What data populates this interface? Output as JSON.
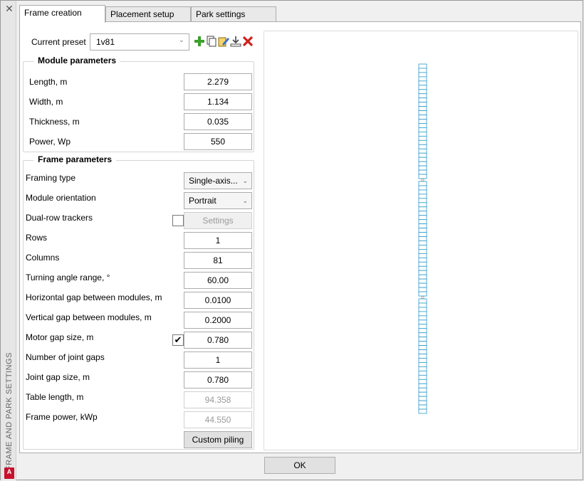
{
  "window": {
    "vertical_title": "FRAME AND PARK SETTINGS",
    "logo_letter": "A"
  },
  "tabs": [
    {
      "label": "Frame creation"
    },
    {
      "label": "Placement setup"
    },
    {
      "label": "Park settings"
    }
  ],
  "preset": {
    "label": "Current preset",
    "value": "1v81",
    "icons": [
      "add-preset-icon",
      "copy-preset-icon",
      "edit-preset-icon",
      "export-preset-icon",
      "delete-preset-icon"
    ]
  },
  "module_parameters": {
    "title": "Module parameters",
    "rows": [
      {
        "label": "Length, m",
        "value": "2.279"
      },
      {
        "label": "Width, m",
        "value": "1.134"
      },
      {
        "label": "Thickness, m",
        "value": "0.035"
      },
      {
        "label": "Power, Wp",
        "value": "550"
      }
    ]
  },
  "frame_parameters": {
    "title": "Frame parameters",
    "framing_type": {
      "label": "Framing type",
      "value": "Single-axis..."
    },
    "module_orientation": {
      "label": "Module orientation",
      "value": "Portrait"
    },
    "dual_row": {
      "label": "Dual-row trackers",
      "checked": false,
      "settings_label": "Settings"
    },
    "rows": {
      "label": "Rows",
      "value": "1"
    },
    "columns": {
      "label": "Columns",
      "value": "81"
    },
    "turning_angle": {
      "label": "Turning angle range, °",
      "value": "60.00"
    },
    "h_gap": {
      "label": "Horizontal gap between modules, m",
      "value": "0.0100"
    },
    "v_gap": {
      "label": "Vertical gap between modules, m",
      "value": "0.2000"
    },
    "motor_gap": {
      "label": "Motor gap size, m",
      "checked": true,
      "value": "0.780"
    },
    "joint_gaps": {
      "label": "Number of joint gaps",
      "value": "1"
    },
    "joint_gap_size": {
      "label": "Joint gap size, m",
      "value": "0.780"
    },
    "table_length": {
      "label": "Table length, m",
      "value": "94.358"
    },
    "frame_power": {
      "label": "Frame power, kWp",
      "value": "44.550"
    },
    "custom_piling_label": "Custom piling"
  },
  "ok_label": "OK",
  "colors": {
    "module_stroke": "#2a9ac8",
    "delete_red": "#d0201c",
    "add_green": "#3aa12a"
  }
}
